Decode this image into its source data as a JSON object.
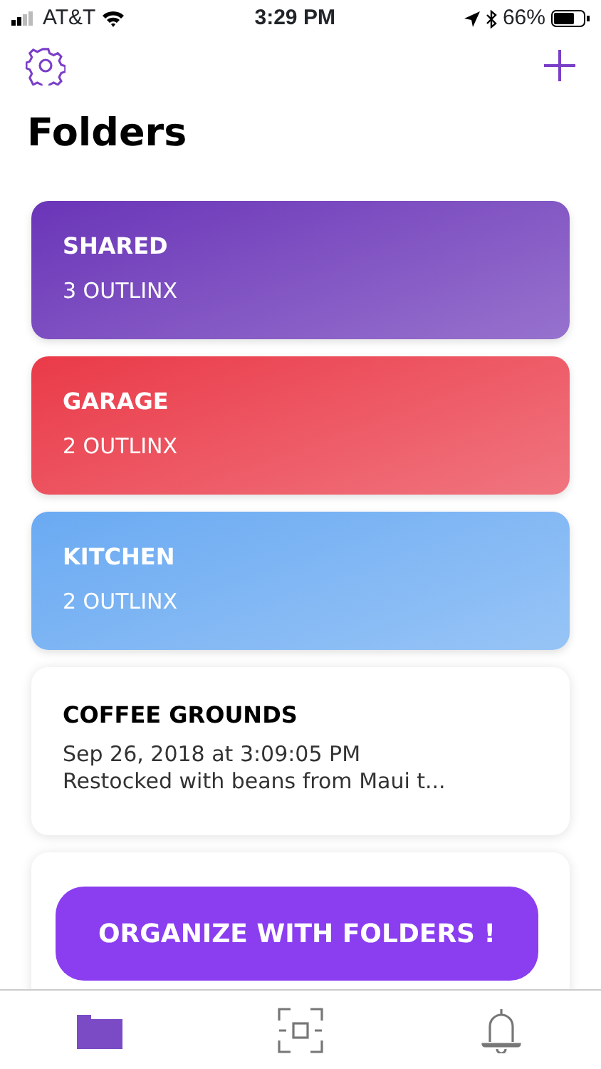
{
  "status_bar": {
    "carrier": "AT&T",
    "time": "3:29 PM",
    "battery": "66%"
  },
  "header": {
    "title": "Folders"
  },
  "cards": [
    {
      "kind": "folder",
      "title": "SHARED",
      "subtitle": "3 OUTLINX",
      "color": "#6a35b8"
    },
    {
      "kind": "folder",
      "title": "GARAGE",
      "subtitle": "2 OUTLINX",
      "color": "#ea3a48"
    },
    {
      "kind": "folder",
      "title": "KITCHEN",
      "subtitle": "2 OUTLINX",
      "color": "#6aaaf2"
    },
    {
      "kind": "note",
      "title": "COFFEE GROUNDS",
      "date": "Sep 26, 2018 at 3:09:05 PM",
      "preview": "Restocked with beans from Maui t..."
    },
    {
      "kind": "blank"
    }
  ],
  "promo_button": "ORGANIZE WITH FOLDERS !",
  "tab_bar": [
    {
      "kind": "folder",
      "selected": true
    },
    {
      "kind": "scan",
      "selected": false
    },
    {
      "kind": "bell",
      "selected": false
    }
  ]
}
